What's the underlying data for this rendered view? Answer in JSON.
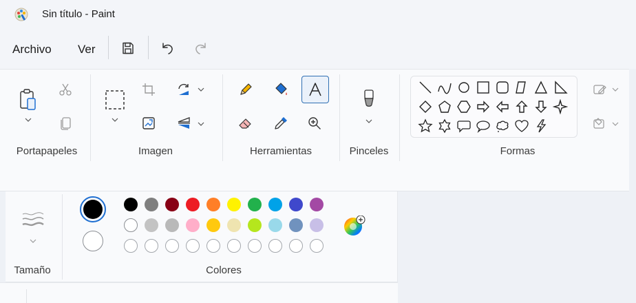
{
  "window": {
    "title": "Sin título - Paint"
  },
  "menu": {
    "file": "Archivo",
    "view": "Ver"
  },
  "quick": {
    "save_icon": "save-icon",
    "undo_icon": "undo-icon",
    "redo_icon": "redo-icon"
  },
  "ribbon": {
    "groups": {
      "clipboard": "Portapapeles",
      "image": "Imagen",
      "tools": "Herramientas",
      "brushes": "Pinceles",
      "shapes": "Formas"
    }
  },
  "size_panel": {
    "label": "Tamaño"
  },
  "colors_panel": {
    "label": "Colores",
    "primary": "#000000",
    "secondary": "#ffffff",
    "palette_row1": [
      "#000000",
      "#7f7f7f",
      "#880015",
      "#ed1c24",
      "#ff7f27",
      "#fff200",
      "#22b14c",
      "#00a2e8",
      "#3f48cc",
      "#a349a4"
    ],
    "palette_row2": [
      "#ffffff",
      "#c3c3c3",
      "#b9b9b9",
      "#ffaec9",
      "#ffc90e",
      "#efe4b0",
      "#b5e61d",
      "#99d9ea",
      "#7092be",
      "#c8bfe7"
    ]
  },
  "colors": {
    "accent": "#2f6fb3"
  }
}
